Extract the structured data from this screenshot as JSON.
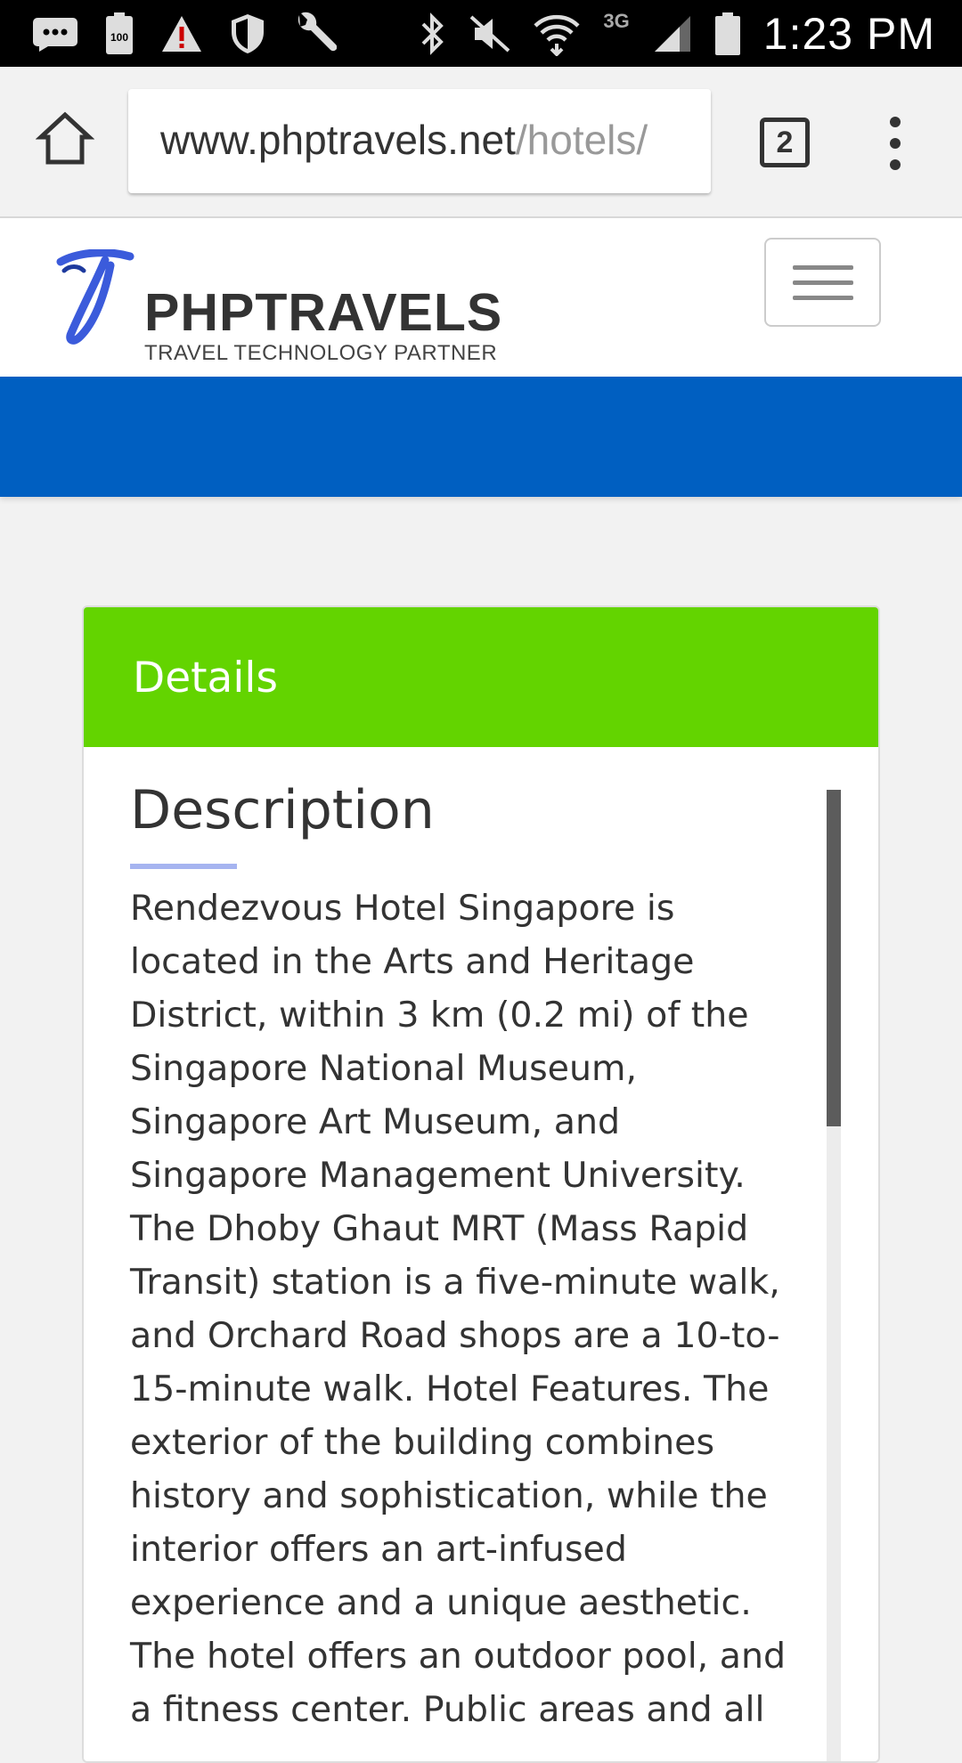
{
  "status_bar": {
    "time": "1:23 PM",
    "network": "3G",
    "left_icons": [
      "chat-icon",
      "battery-100-icon",
      "alert-icon",
      "shield-icon",
      "wrench-icon"
    ],
    "right_icons": [
      "bluetooth-icon",
      "mute-icon",
      "wifi-icon",
      "signal-icon",
      "battery-icon"
    ]
  },
  "browser": {
    "url_domain": "www.phptravels.net",
    "url_path": "/hotels/",
    "tab_count": "2"
  },
  "site": {
    "logo_title": "PHPTRAVELS",
    "logo_subtitle": "TRAVEL TECHNOLOGY PARTNER",
    "brand_color": "#005fc1"
  },
  "details": {
    "header": "Details",
    "header_color": "#63d400",
    "section_title": "Description",
    "description": "Rendezvous Hotel Singapore is located in the Arts and Heritage District, within 3 km (0.2 mi) of the Singapore National Museum, Singapore Art Museum, and Singapore Management University. The Dhoby Ghaut MRT (Mass Rapid Transit) station is a five-minute walk, and Orchard Road shops are a 10-to-15-minute walk. Hotel Features. The exterior of the building combines history and sophistication, while the interior offers an art-infused experience and a unique aesthetic. The hotel offers an outdoor pool, and a fitness center. Public areas and all"
  }
}
